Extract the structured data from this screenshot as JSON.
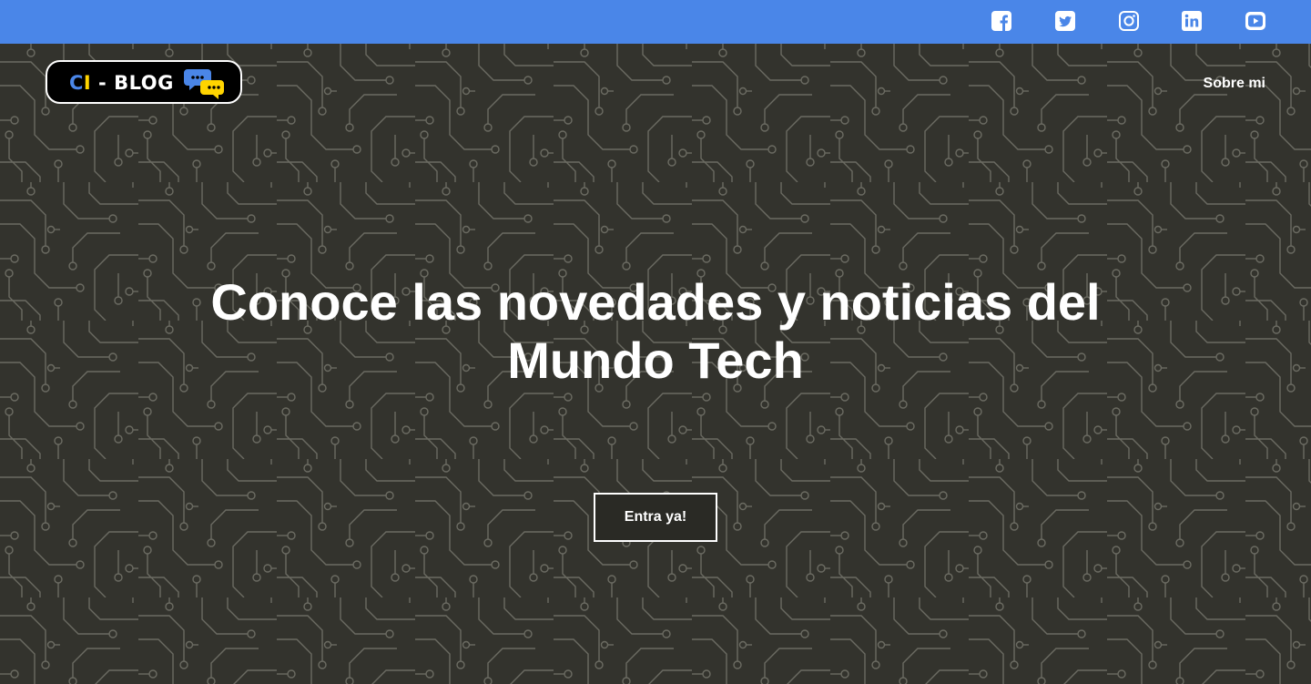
{
  "colors": {
    "topbar": "#4a86e8",
    "hero_background": "#33332d",
    "circuit_lines": "#6b6b62",
    "logo_background": "#000000",
    "logo_c": "#4a86e8",
    "logo_i": "#ffd400",
    "bubble_blue": "#4a86e8",
    "bubble_yellow": "#ffd400"
  },
  "social": [
    {
      "name": "facebook",
      "icon": "facebook-icon"
    },
    {
      "name": "twitter",
      "icon": "twitter-icon"
    },
    {
      "name": "instagram",
      "icon": "instagram-icon"
    },
    {
      "name": "linkedin",
      "icon": "linkedin-icon"
    },
    {
      "name": "youtube",
      "icon": "youtube-icon"
    }
  ],
  "logo": {
    "c": "C",
    "i": "I",
    "rest": " - BLOG",
    "icon": "chat-bubbles-icon"
  },
  "nav": {
    "about": "Sobre mi"
  },
  "hero": {
    "title": "Conoce las novedades y noticias del Mundo Tech",
    "cta": "Entra ya!",
    "background": "circuit-board-pattern"
  }
}
